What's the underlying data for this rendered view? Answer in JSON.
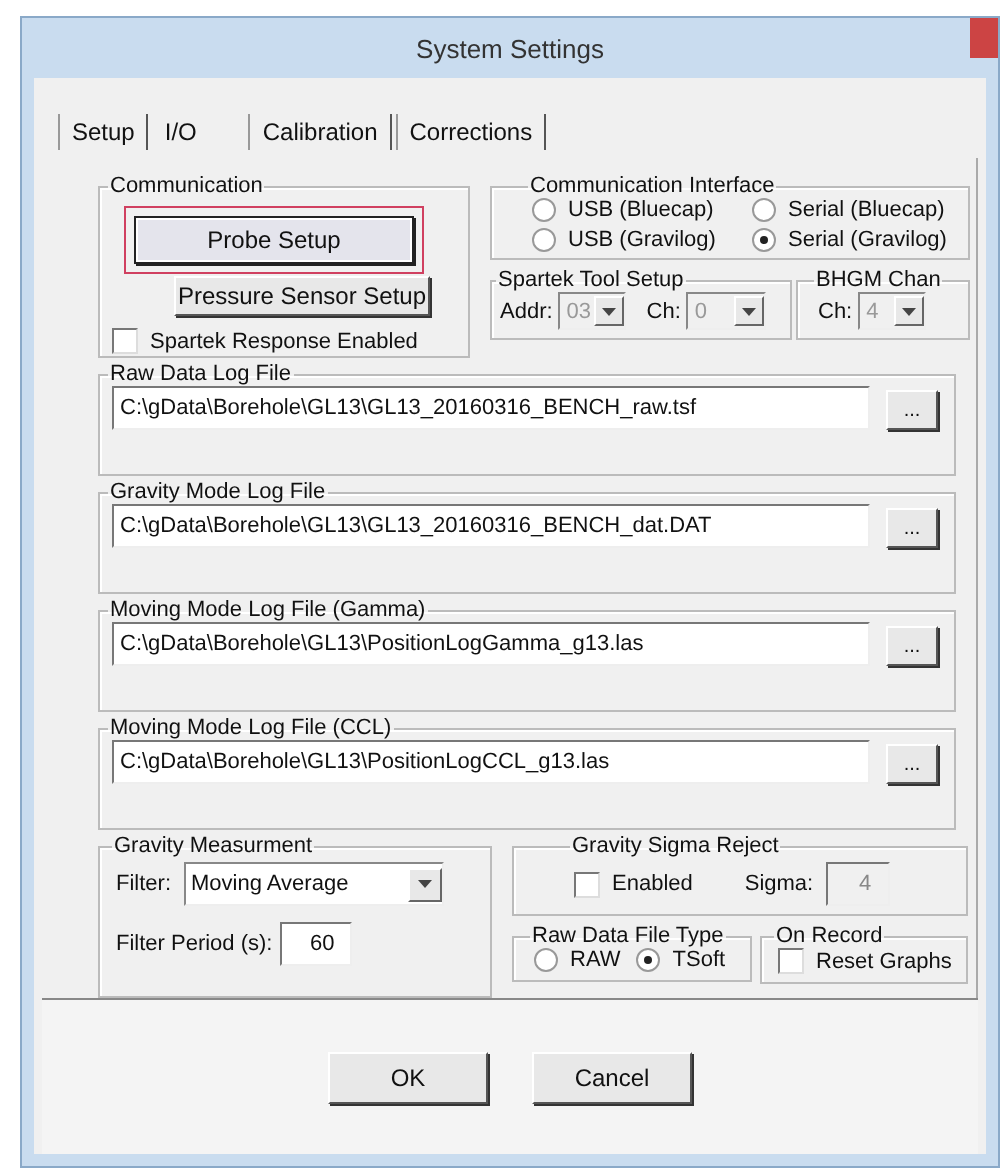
{
  "window": {
    "title": "System Settings"
  },
  "tabs": [
    {
      "label": "Setup",
      "selected": false
    },
    {
      "label": "I/O",
      "selected": true
    },
    {
      "label": "Calibration",
      "selected": false
    },
    {
      "label": "Corrections",
      "selected": false
    }
  ],
  "communication": {
    "title": "Communication",
    "buttons": [
      {
        "label": "Probe Setup",
        "focused": true
      },
      {
        "label": "Pressure Sensor Setup",
        "focused": false
      }
    ],
    "checkbox": {
      "label": "Spartek Response Enabled",
      "checked": false
    }
  },
  "interface": {
    "title": "Communication Interface",
    "options": [
      {
        "label": "USB (Bluecap)",
        "selected": false
      },
      {
        "label": "Serial (Bluecap)",
        "selected": false
      },
      {
        "label": "USB (Gravilog)",
        "selected": false
      },
      {
        "label": "Serial (Gravilog)",
        "selected": true
      }
    ]
  },
  "spartek": {
    "title": "Spartek Tool Setup",
    "fields": [
      {
        "label": "Addr:",
        "value": "03",
        "disabled": true
      },
      {
        "label": "Ch:",
        "value": "0",
        "disabled": true
      }
    ]
  },
  "bhgm": {
    "title": "BHGM Chan",
    "fields": [
      {
        "label": "Ch:",
        "value": "4",
        "disabled": true
      }
    ]
  },
  "log_files": [
    {
      "title": "Raw Data Log File",
      "path": "C:\\gData\\Borehole\\GL13\\GL13_20160316_BENCH_raw.tsf",
      "browse": "..."
    },
    {
      "title": "Gravity Mode Log File",
      "path": "C:\\gData\\Borehole\\GL13\\GL13_20160316_BENCH_dat.DAT",
      "browse": "..."
    },
    {
      "title": "Moving Mode Log File (Gamma)",
      "path": "C:\\gData\\Borehole\\GL13\\PositionLogGamma_g13.las",
      "browse": "..."
    },
    {
      "title": "Moving Mode Log File (CCL)",
      "path": "C:\\gData\\Borehole\\GL13\\PositionLogCCL_g13.las",
      "browse": "..."
    }
  ],
  "gravity_measurement": {
    "title": "Gravity Measurment",
    "filter_label": "Filter:",
    "filter_value": "Moving Average",
    "period_label": "Filter Period (s):",
    "period_value": "60"
  },
  "sigma_reject": {
    "title": "Gravity Sigma Reject",
    "checkbox": {
      "label": "Enabled",
      "checked": false
    },
    "sigma_label": "Sigma:",
    "sigma_value": "4",
    "sigma_disabled": true
  },
  "raw_file_type": {
    "title": "Raw Data File Type",
    "options": [
      {
        "label": "RAW",
        "selected": false
      },
      {
        "label": "TSoft",
        "selected": true
      }
    ]
  },
  "on_record": {
    "title": "On Record",
    "checkbox": {
      "label": "Reset Graphs",
      "checked": false
    }
  },
  "buttons": [
    {
      "label": "OK"
    },
    {
      "label": "Cancel"
    }
  ]
}
